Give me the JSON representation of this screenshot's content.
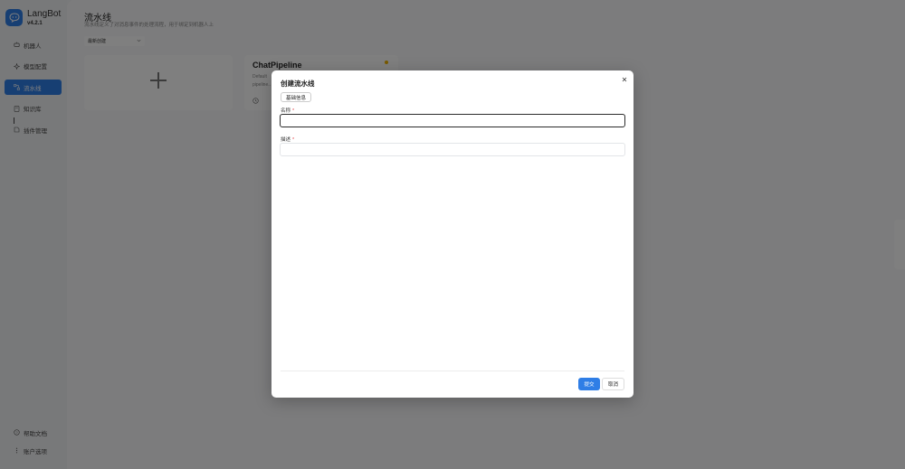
{
  "app": {
    "name": "LangBot",
    "version": "v4.2.1",
    "accent_color": "#2f7ee6"
  },
  "sidebar": {
    "items": [
      {
        "label": "机器人",
        "icon": "robot-icon",
        "active": false
      },
      {
        "label": "模型配置",
        "icon": "sparkle-icon",
        "active": false
      },
      {
        "label": "流水线",
        "icon": "pipeline-icon",
        "active": true
      },
      {
        "label": "知识库",
        "icon": "book-icon",
        "active": false
      },
      {
        "label": "插件管理",
        "icon": "plugin-icon",
        "active": false
      }
    ],
    "bottom_items": [
      {
        "label": "帮助文档",
        "icon": "help-icon"
      },
      {
        "label": "账户选项",
        "icon": "more-icon"
      }
    ]
  },
  "page": {
    "title": "流水线",
    "subtitle": "流水线定义了对消息事件的处理流程，用于绑定到机器人上",
    "sort_value": "最新创建"
  },
  "pipeline_card": {
    "title": "ChatPipeline",
    "description": "Default pipeline..."
  },
  "dialog": {
    "title": "创建流水线",
    "tab_label": "基础信息",
    "name_label": "名称",
    "name_value": "",
    "description_label": "描述",
    "description_value": "",
    "required_mark": "*",
    "submit_label": "提交",
    "cancel_label": "取消"
  }
}
